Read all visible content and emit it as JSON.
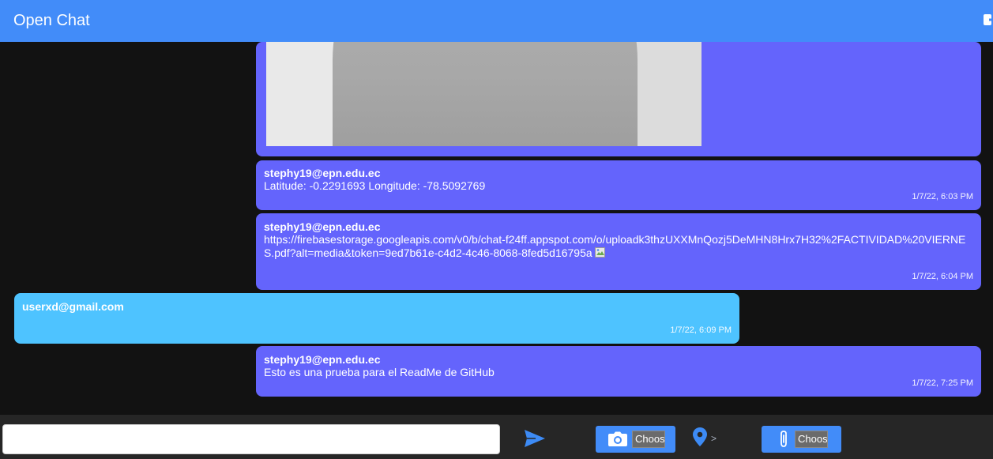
{
  "app": {
    "title": "Open Chat"
  },
  "header": {
    "logout_icon": "logout-icon"
  },
  "messages": [
    {
      "type": "image",
      "side": "sent"
    },
    {
      "side": "sent",
      "sender": "stephy19@epn.edu.ec",
      "text": "Latitude: -0.2291693 Longitude: -78.5092769",
      "time": "1/7/22, 6:03 PM"
    },
    {
      "side": "sent",
      "sender": "stephy19@epn.edu.ec",
      "text": "https://firebasestorage.googleapis.com/v0/b/chat-f24ff.appspot.com/o/uploadk3thzUXXMnQozj5DeMHN8Hrx7H32%2FACTIVIDAD%20VIERNES.pdf?alt=media&token=9ed7b61e-c4d2-4c46-8068-8fed5d16795a",
      "time": "1/7/22, 6:04 PM"
    },
    {
      "side": "received",
      "sender": "userxd@gmail.com",
      "text": "",
      "time": "1/7/22, 6:09 PM"
    },
    {
      "side": "sent",
      "sender": "stephy19@epn.edu.ec",
      "text": "Esto es una prueba para el ReadMe de GitHub",
      "time": "1/7/22, 7:25 PM"
    }
  ],
  "composer": {
    "input_value": "",
    "send_icon": "send-icon",
    "photo_icon": "camera-icon",
    "photo_choose_label": "Choos",
    "location_icon": "map-pin-icon",
    "location_chevron": ">",
    "file_icon": "paperclip-icon",
    "file_choose_label": "Choos"
  },
  "colors": {
    "header": "#428cf9",
    "background": "#121212",
    "sent_bubble": "#6464fc",
    "received_bubble": "#4ec3ff",
    "footer": "#262626"
  }
}
